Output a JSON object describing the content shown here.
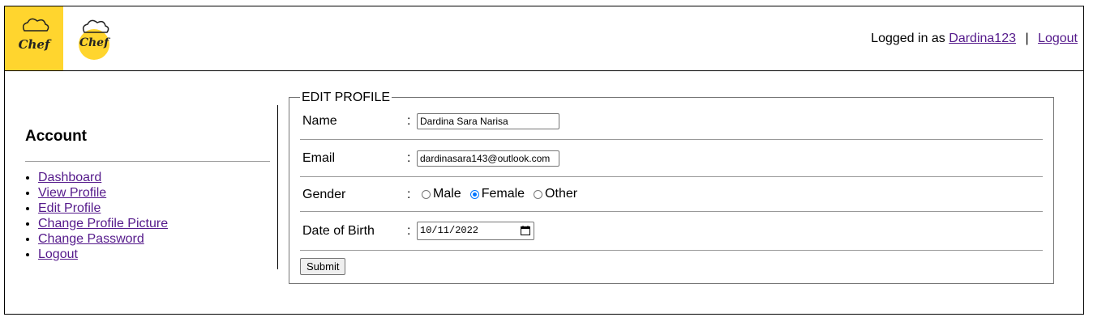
{
  "header": {
    "logged_in_prefix": "Logged in as",
    "username": "Dardina123",
    "separator": "|",
    "logout_label": "Logout",
    "logo_text": "Chef"
  },
  "sidebar": {
    "title": "Account",
    "items": [
      {
        "label": "Dashboard"
      },
      {
        "label": "View Profile"
      },
      {
        "label": "Edit Profile"
      },
      {
        "label": "Change Profile Picture"
      },
      {
        "label": "Change Password"
      },
      {
        "label": "Logout"
      }
    ]
  },
  "form": {
    "legend": "EDIT PROFILE",
    "colon": ":",
    "name": {
      "label": "Name",
      "value": "Dardina Sara Narisa"
    },
    "email": {
      "label": "Email",
      "value": "dardinasara143@outlook.com"
    },
    "gender": {
      "label": "Gender",
      "options": [
        {
          "label": "Male",
          "checked": false
        },
        {
          "label": "Female",
          "checked": true
        },
        {
          "label": "Other",
          "checked": false
        }
      ]
    },
    "dob": {
      "label": "Date of Birth",
      "value": "10/11/2022"
    },
    "submit_label": "Submit"
  },
  "colors": {
    "logo_bg": "#ffd52e",
    "link": "#551a8b",
    "radio_checked": "#0075ff"
  }
}
